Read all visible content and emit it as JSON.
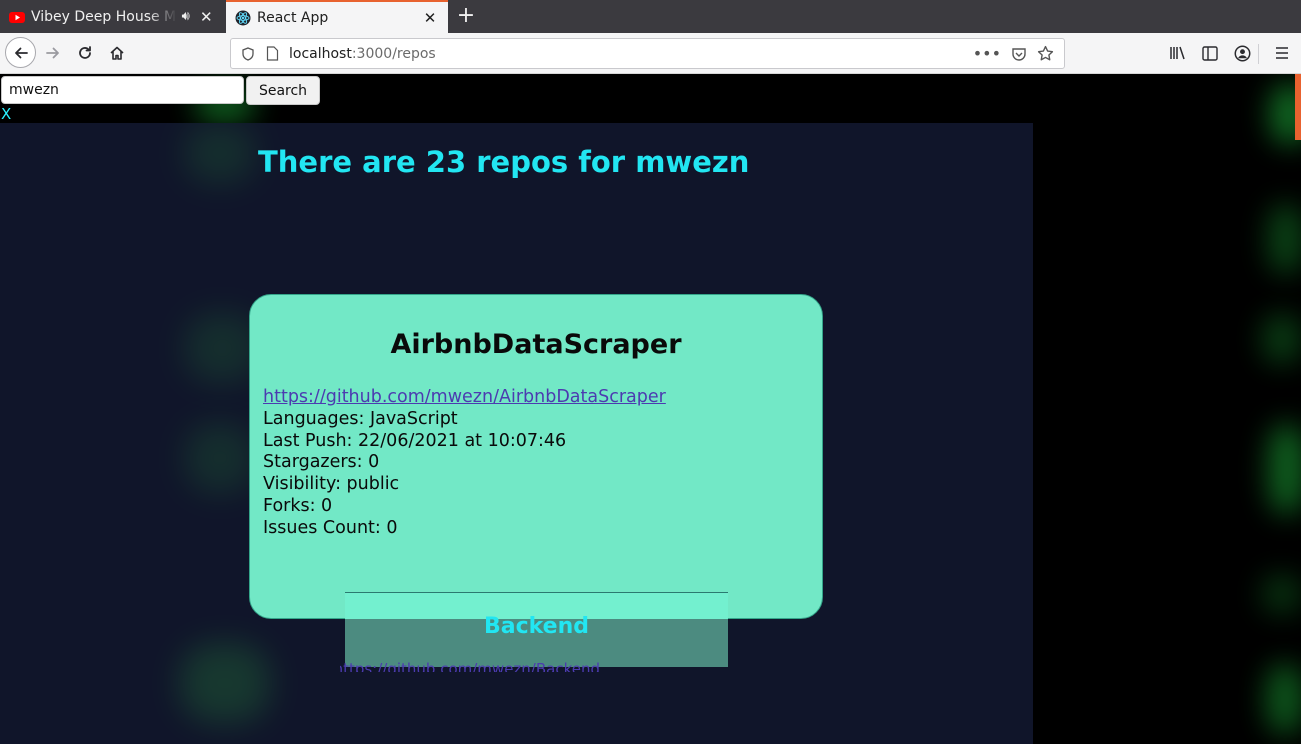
{
  "browser": {
    "tabs": [
      {
        "title": "Vibey Deep House Mi",
        "favicon": "youtube-icon",
        "audio": true
      },
      {
        "title": "React App",
        "favicon": "react-icon",
        "active": true
      }
    ],
    "url_host": "localhost",
    "url_path": ":3000/repos"
  },
  "search": {
    "value": "mwezn",
    "button_label": "Search",
    "clear_label": "X"
  },
  "headline": "There are 23 repos for mwezn",
  "repos": [
    {
      "name": "AirbnbDataScraper",
      "url": "https://github.com/mwezn/AirbnbDataScraper",
      "languages": "Languages: JavaScript",
      "last_push": "Last Push: 22/06/2021 at 10:07:46",
      "stargazers": "Stargazers: 0",
      "visibility": "Visibility: public",
      "forks": "Forks: 0",
      "issues": "Issues Count: 0"
    },
    {
      "name": "Backend",
      "url": "https://github.com/mwezn/Backend"
    }
  ],
  "colors": {
    "headline": "#22e6f2",
    "card": "#72e8c6",
    "page_bg": "#10152a",
    "link": "#4c3bb0"
  }
}
